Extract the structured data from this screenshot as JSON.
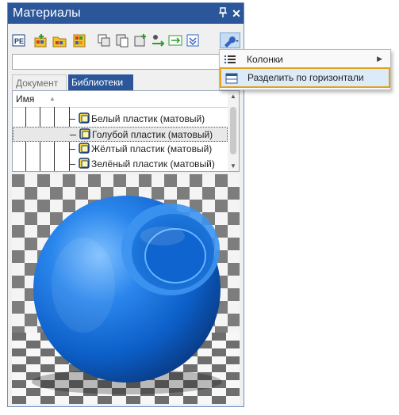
{
  "panel": {
    "title": "Материалы",
    "pin_glyph": "⬇",
    "close_glyph": "✕"
  },
  "toolbar": {
    "icons": [
      "properties-icon",
      "add-library-icon",
      "open-folder-icon",
      "new-library-icon",
      "copy-icon",
      "paste-icon",
      "new-material-icon",
      "eyedropper-icon",
      "replace-icon",
      "filter-icon",
      "settings-wrench-icon"
    ]
  },
  "combo": {
    "value": ""
  },
  "tabs": [
    {
      "label": "Документ",
      "active": false
    },
    {
      "label": "Библиотеки",
      "active": true
    }
  ],
  "list": {
    "column_header": "Имя",
    "items": [
      {
        "label": "Белый пластик (матовый)",
        "selected": false
      },
      {
        "label": "Голубой пластик (матовый)",
        "selected": true
      },
      {
        "label": "Жёлтый пластик (матовый)",
        "selected": false
      },
      {
        "label": "Зелёный пластик (матовый)",
        "selected": false
      }
    ]
  },
  "context_menu": {
    "items": [
      {
        "label": "Колонки",
        "icon": "columns-list-icon",
        "has_submenu": true,
        "highlighted": false
      },
      {
        "label": "Разделить по горизонтали",
        "icon": "split-horizontal-icon",
        "has_submenu": false,
        "highlighted": true
      }
    ]
  },
  "colors": {
    "title_bar": "#2b579a",
    "active_tab": "#2b579a",
    "highlight_border": "#e3a21a",
    "sphere": "#1f74d8"
  }
}
